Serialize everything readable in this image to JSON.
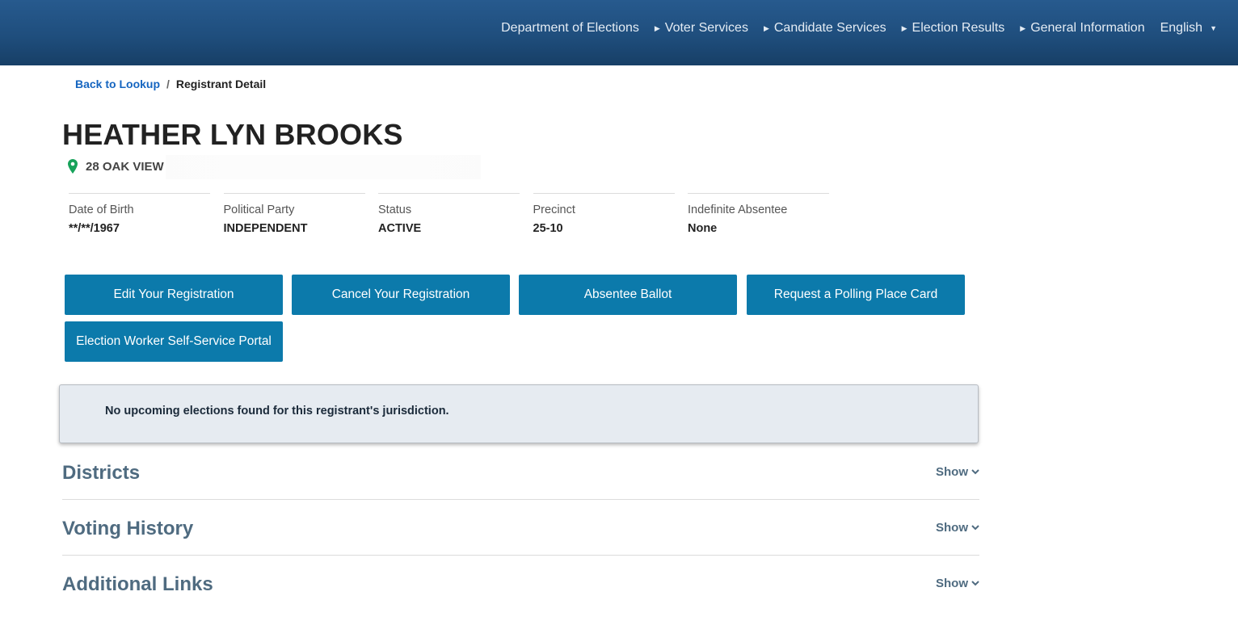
{
  "nav": {
    "items": [
      {
        "label": "Department of Elections"
      },
      {
        "label": "Voter Services"
      },
      {
        "label": "Candidate Services"
      },
      {
        "label": "Election Results"
      },
      {
        "label": "General Information"
      }
    ],
    "language": "English"
  },
  "breadcrumb": {
    "back_label": "Back to Lookup",
    "separator": "/",
    "current": "Registrant Detail"
  },
  "registrant": {
    "name": "HEATHER LYN BROOKS",
    "address": "28 OAK VIEW",
    "address_icon": "map-pin-icon"
  },
  "fields": [
    {
      "label": "Date of Birth",
      "value": "**/**/1967"
    },
    {
      "label": "Political Party",
      "value": "INDEPENDENT"
    },
    {
      "label": "Status",
      "value": "ACTIVE"
    },
    {
      "label": "Precinct",
      "value": "25-10"
    },
    {
      "label": "Indefinite Absentee",
      "value": "None"
    }
  ],
  "actions": {
    "edit": "Edit Your Registration",
    "cancel": "Cancel Your Registration",
    "absentee": "Absentee Ballot",
    "polling_card": "Request a Polling Place Card",
    "worker_portal": "Election Worker Self-Service Portal"
  },
  "notice": "No upcoming elections found for this registrant's jurisdiction.",
  "sections": [
    {
      "title": "Districts",
      "toggle": "Show"
    },
    {
      "title": "Voting History",
      "toggle": "Show"
    },
    {
      "title": "Additional Links",
      "toggle": "Show"
    }
  ],
  "colors": {
    "header_bg": "#1f4e7d",
    "button_bg": "#0c7aab",
    "link": "#1565c0",
    "section_title": "#4f6b80",
    "notice_bg": "#e6ebf1",
    "pin": "#17a25a"
  }
}
